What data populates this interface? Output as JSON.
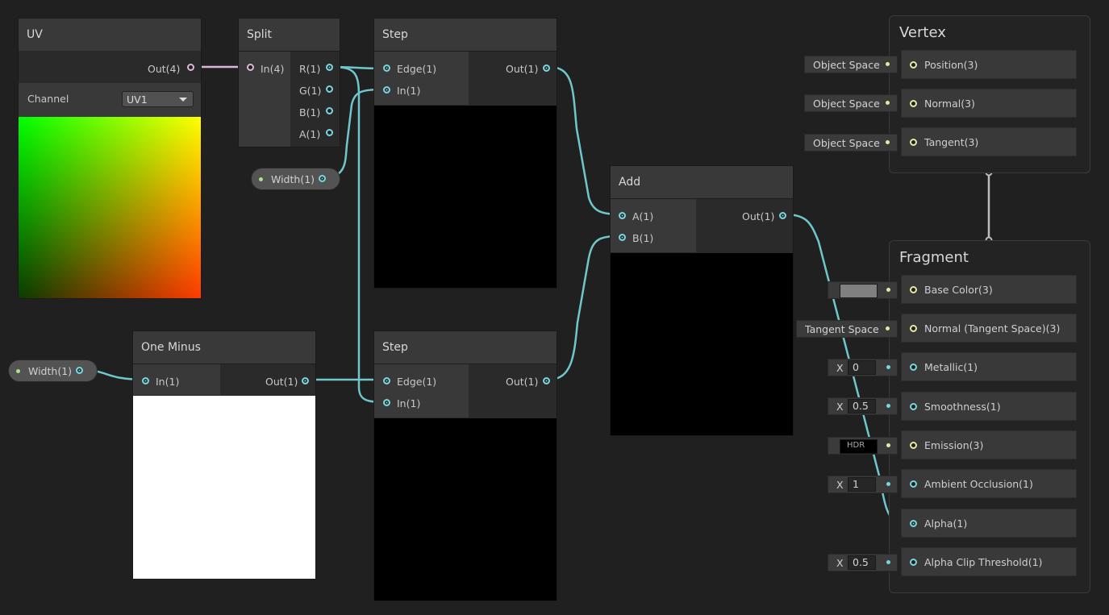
{
  "uv_node": {
    "title": "UV",
    "out": "Out(4)",
    "channel_label": "Channel",
    "channel_value": "UV1"
  },
  "split_node": {
    "title": "Split",
    "in": "In(4)",
    "outs": [
      "R(1)",
      "G(1)",
      "B(1)",
      "A(1)"
    ]
  },
  "width_top": {
    "label": "Width(1)"
  },
  "width_left": {
    "label": "Width(1)"
  },
  "step_top": {
    "title": "Step",
    "edge": "Edge(1)",
    "in": "In(1)",
    "out": "Out(1)"
  },
  "step_bottom": {
    "title": "Step",
    "edge": "Edge(1)",
    "in": "In(1)",
    "out": "Out(1)"
  },
  "one_minus": {
    "title": "One Minus",
    "in": "In(1)",
    "out": "Out(1)"
  },
  "add_node": {
    "title": "Add",
    "a": "A(1)",
    "b": "B(1)",
    "out": "Out(1)"
  },
  "vertex": {
    "title": "Vertex",
    "slots": [
      {
        "inline": "Object Space",
        "label": "Position(3)"
      },
      {
        "inline": "Object Space",
        "label": "Normal(3)"
      },
      {
        "inline": "Object Space",
        "label": "Tangent(3)"
      }
    ]
  },
  "fragment": {
    "title": "Fragment",
    "base_color": {
      "label": "Base Color(3)",
      "swatch": "#808080"
    },
    "normal": {
      "inline": "Tangent Space",
      "label": "Normal (Tangent Space)(3)"
    },
    "metallic": {
      "axis": "X",
      "value": "0",
      "label": "Metallic(1)"
    },
    "smoothness": {
      "axis": "X",
      "value": "0.5",
      "label": "Smoothness(1)"
    },
    "emission": {
      "inline": "HDR",
      "label": "Emission(3)"
    },
    "ao": {
      "axis": "X",
      "value": "1",
      "label": "Ambient Occlusion(1)"
    },
    "alpha": {
      "label": "Alpha(1)"
    },
    "alpha_clip": {
      "axis": "X",
      "value": "0.5",
      "label": "Alpha Clip Threshold(1)"
    }
  },
  "colors": {
    "wire": "#6fc7cc",
    "uv_wire": "#e0b6d8",
    "vector_port": "#e8e9a0",
    "background": "#202020"
  }
}
